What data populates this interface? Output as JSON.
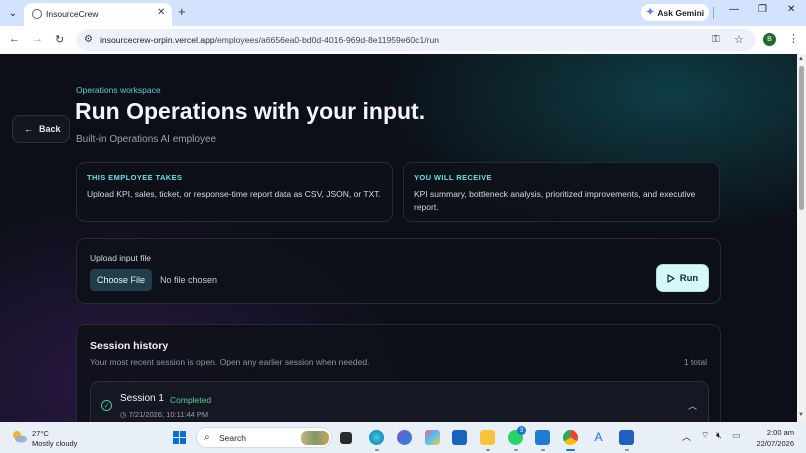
{
  "browser": {
    "tab_title": "InsourceCrew",
    "new_tab_symbol": "+",
    "gemini_label": "Ask Gemini",
    "url_host": "insourcecrew-orpin.vercel.app",
    "url_path": "/employees/a6656ea0-bd0d-4016-969d-8e11959e60c1/run",
    "profile_initial": "B"
  },
  "page": {
    "back_label": "Back",
    "eyebrow": "Operations workspace",
    "title": "Run Operations with your input.",
    "subtitle": "Built-in Operations AI employee",
    "takes": {
      "label": "THIS EMPLOYEE TAKES",
      "text": "Upload KPI, sales, ticket, or response-time report data as CSV, JSON, or TXT."
    },
    "receive": {
      "label": "YOU WILL RECEIVE",
      "text": "KPI summary, bottleneck analysis, prioritized improvements, and executive report."
    },
    "upload": {
      "label": "Upload input file",
      "choose_button": "Choose File",
      "file_status": "No file chosen",
      "run_button": "Run"
    },
    "session_history": {
      "title": "Session history",
      "subtitle": "Your most recent session is open. Open any earlier session when needed.",
      "count": "1 total",
      "sessions": [
        {
          "name": "Session 1",
          "status": "Completed",
          "timestamp": "7/21/2026, 10:11:44 PM"
        }
      ]
    }
  },
  "taskbar": {
    "weather_temp": "27°C",
    "weather_desc": "Mostly cloudy",
    "search_placeholder": "Search",
    "whatsapp_badge": "3",
    "time": "2:00 am",
    "date": "22/07/2026"
  },
  "colors": {
    "accent_cyan": "#5ad1d6",
    "completed_green": "#4fd19a",
    "page_bg": "#0c0f17"
  }
}
